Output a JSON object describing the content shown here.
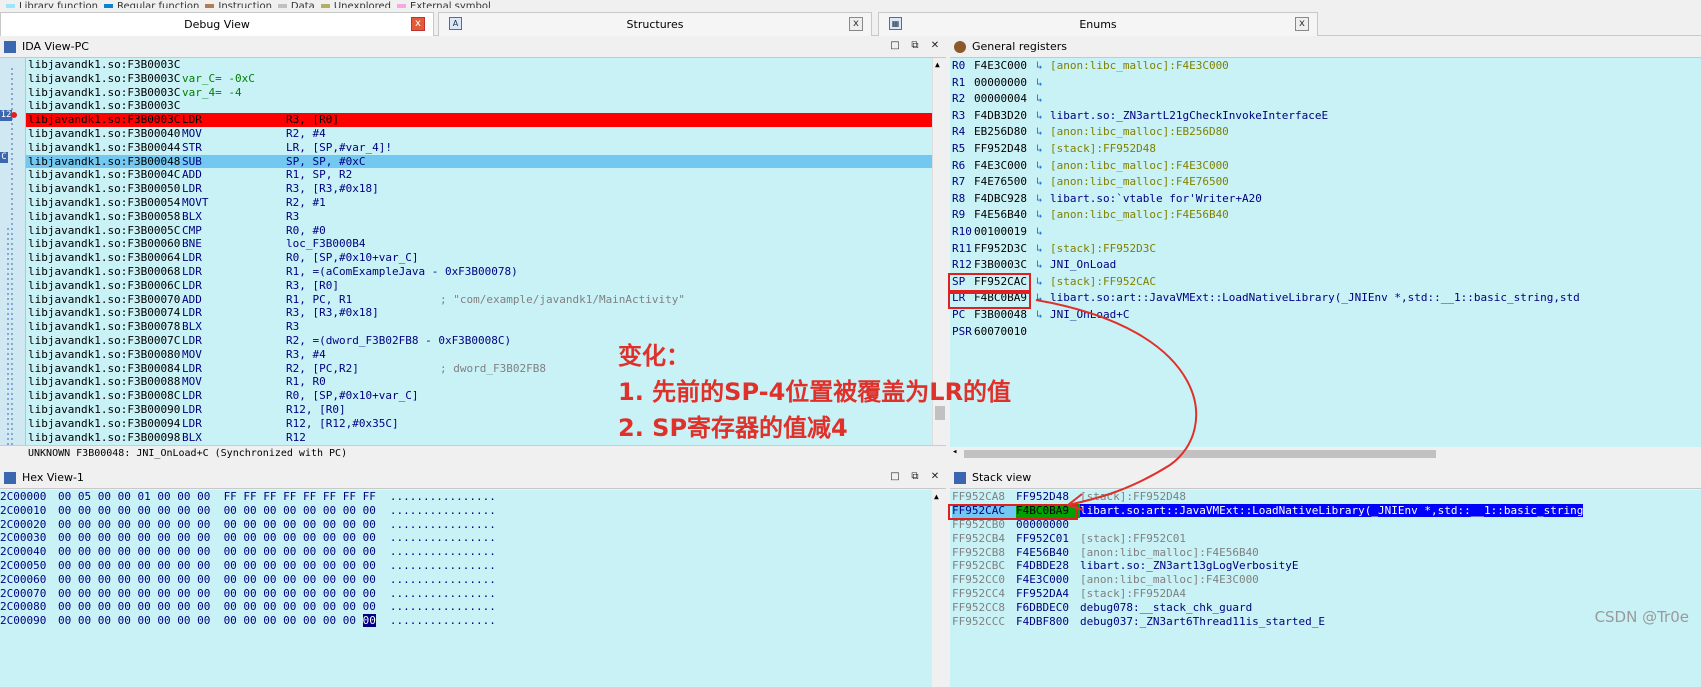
{
  "legend": [
    {
      "label": "Library function",
      "color": "#9be6ff"
    },
    {
      "label": "Regular function",
      "color": "#0a84d0"
    },
    {
      "label": "Instruction",
      "color": "#b47c52"
    },
    {
      "label": "Data",
      "color": "#c0c0c0"
    },
    {
      "label": "Unexplored",
      "color": "#b0b060"
    },
    {
      "label": "External symbol",
      "color": "#f7a6e8"
    }
  ],
  "tabs": [
    {
      "label": "Debug View",
      "close": "x"
    },
    {
      "label": "Structures",
      "close": "x"
    },
    {
      "label": "Enums",
      "close": "x"
    }
  ],
  "ida": {
    "title": "IDA View-PC",
    "gutter_marks": [
      "12",
      "C"
    ],
    "lines": [
      {
        "addr": "libjavandk1.so:F3B0003C",
        "mn": "",
        "ops": "",
        "cm": "",
        "var": "",
        "style": ""
      },
      {
        "addr": "libjavandk1.so:F3B0003C",
        "mn": "",
        "ops": "",
        "cm": "",
        "var": "var_C= -0xC",
        "style": ""
      },
      {
        "addr": "libjavandk1.so:F3B0003C",
        "mn": "",
        "ops": "",
        "cm": "",
        "var": "var_4= -4",
        "style": ""
      },
      {
        "addr": "libjavandk1.so:F3B0003C",
        "mn": "",
        "ops": "",
        "cm": "",
        "var": "",
        "style": ""
      },
      {
        "addr": "libjavandk1.so:F3B0003C",
        "mn": "LDR",
        "ops": "R3, [R0]",
        "cm": "",
        "var": "",
        "style": "red"
      },
      {
        "addr": "libjavandk1.so:F3B00040",
        "mn": "MOV",
        "ops": "R2, #4",
        "cm": "",
        "var": "",
        "style": ""
      },
      {
        "addr": "libjavandk1.so:F3B00044",
        "mn": "STR",
        "ops": "LR, [SP,#var_4]!",
        "cm": "",
        "var": "",
        "style": ""
      },
      {
        "addr": "libjavandk1.so:F3B00048",
        "mn": "SUB",
        "ops": "SP, SP, #0xC",
        "cm": "",
        "var": "",
        "style": "blue"
      },
      {
        "addr": "libjavandk1.so:F3B0004C",
        "mn": "ADD",
        "ops": "R1, SP, R2",
        "cm": "",
        "var": "",
        "style": ""
      },
      {
        "addr": "libjavandk1.so:F3B00050",
        "mn": "LDR",
        "ops": "R3, [R3,#0x18]",
        "cm": "",
        "var": "",
        "style": ""
      },
      {
        "addr": "libjavandk1.so:F3B00054",
        "mn": "MOVT",
        "ops": "R2, #1",
        "cm": "",
        "var": "",
        "style": ""
      },
      {
        "addr": "libjavandk1.so:F3B00058",
        "mn": "BLX",
        "ops": "R3",
        "cm": "",
        "var": "",
        "style": ""
      },
      {
        "addr": "libjavandk1.so:F3B0005C",
        "mn": "CMP",
        "ops": "R0, #0",
        "cm": "",
        "var": "",
        "style": ""
      },
      {
        "addr": "libjavandk1.so:F3B00060",
        "mn": "BNE",
        "ops": "loc_F3B000B4",
        "cm": "",
        "var": "",
        "style": ""
      },
      {
        "addr": "libjavandk1.so:F3B00064",
        "mn": "LDR",
        "ops": "R0, [SP,#0x10+var_C]",
        "cm": "",
        "var": "",
        "style": ""
      },
      {
        "addr": "libjavandk1.so:F3B00068",
        "mn": "LDR",
        "ops": "R1, =(aComExampleJava - 0xF3B00078)",
        "cm": "",
        "var": "",
        "style": ""
      },
      {
        "addr": "libjavandk1.so:F3B0006C",
        "mn": "LDR",
        "ops": "R3, [R0]",
        "cm": "",
        "var": "",
        "style": ""
      },
      {
        "addr": "libjavandk1.so:F3B00070",
        "mn": "ADD",
        "ops": "R1, PC, R1",
        "cm": "; \"com/example/javandk1/MainActivity\"",
        "var": "",
        "style": ""
      },
      {
        "addr": "libjavandk1.so:F3B00074",
        "mn": "LDR",
        "ops": "R3, [R3,#0x18]",
        "cm": "",
        "var": "",
        "style": ""
      },
      {
        "addr": "libjavandk1.so:F3B00078",
        "mn": "BLX",
        "ops": "R3",
        "cm": "",
        "var": "",
        "style": ""
      },
      {
        "addr": "libjavandk1.so:F3B0007C",
        "mn": "LDR",
        "ops": "R2, =(dword_F3B02FB8 - 0xF3B0008C)",
        "cm": "",
        "var": "",
        "style": ""
      },
      {
        "addr": "libjavandk1.so:F3B00080",
        "mn": "MOV",
        "ops": "R3, #4",
        "cm": "",
        "var": "",
        "style": ""
      },
      {
        "addr": "libjavandk1.so:F3B00084",
        "mn": "LDR",
        "ops": "R2, [PC,R2]",
        "cm": "; dword_F3B02FB8",
        "var": "",
        "style": ""
      },
      {
        "addr": "libjavandk1.so:F3B00088",
        "mn": "MOV",
        "ops": "R1, R0",
        "cm": "",
        "var": "",
        "style": ""
      },
      {
        "addr": "libjavandk1.so:F3B0008C",
        "mn": "LDR",
        "ops": "R0, [SP,#0x10+var_C]",
        "cm": "",
        "var": "",
        "style": ""
      },
      {
        "addr": "libjavandk1.so:F3B00090",
        "mn": "LDR",
        "ops": "R12, [R0]",
        "cm": "",
        "var": "",
        "style": ""
      },
      {
        "addr": "libjavandk1.so:F3B00094",
        "mn": "LDR",
        "ops": "R12, [R12,#0x35C]",
        "cm": "",
        "var": "",
        "style": ""
      },
      {
        "addr": "libjavandk1.so:F3B00098",
        "mn": "BLX",
        "ops": "R12",
        "cm": "",
        "var": "",
        "style": ""
      }
    ],
    "status": "UNKNOWN F3B00048: JNI_OnLoad+C (Synchronized with PC)"
  },
  "registers": {
    "title": "General registers",
    "rows": [
      {
        "name": "R0",
        "value": "F4E3C000",
        "desc": "[anon:libc_malloc]:F4E3C000",
        "code": false
      },
      {
        "name": "R1",
        "value": "00000000",
        "desc": "",
        "code": false
      },
      {
        "name": "R2",
        "value": "00000004",
        "desc": "",
        "code": false
      },
      {
        "name": "R3",
        "value": "F4DB3D20",
        "desc": "libart.so:_ZN3artL21gCheckInvokeInterfaceE",
        "code": true
      },
      {
        "name": "R4",
        "value": "EB256D80",
        "desc": "[anon:libc_malloc]:EB256D80",
        "code": false
      },
      {
        "name": "R5",
        "value": "FF952D48",
        "desc": "[stack]:FF952D48",
        "code": false
      },
      {
        "name": "R6",
        "value": "F4E3C000",
        "desc": "[anon:libc_malloc]:F4E3C000",
        "code": false
      },
      {
        "name": "R7",
        "value": "F4E76500",
        "desc": "[anon:libc_malloc]:F4E76500",
        "code": false
      },
      {
        "name": "R8",
        "value": "F4DBC928",
        "desc": "libart.so:`vtable for'Writer+A20",
        "code": true
      },
      {
        "name": "R9",
        "value": "F4E56B40",
        "desc": "[anon:libc_malloc]:F4E56B40",
        "code": false
      },
      {
        "name": "R10",
        "value": "00100019",
        "desc": "",
        "code": false
      },
      {
        "name": "R11",
        "value": "FF952D3C",
        "desc": "[stack]:FF952D3C",
        "code": false
      },
      {
        "name": "R12",
        "value": "F3B0003C",
        "desc": "JNI_OnLoad",
        "code": true
      },
      {
        "name": "SP",
        "value": "FF952CAC",
        "desc": "[stack]:FF952CAC",
        "code": false
      },
      {
        "name": "LR",
        "value": "F4BC0BA9",
        "desc": "libart.so:art::JavaVMExt::LoadNativeLibrary(_JNIEnv *,std::__1::basic_string,std",
        "code": true
      },
      {
        "name": "PC",
        "value": "F3B00048",
        "desc": "JNI_OnLoad+C",
        "code": true
      },
      {
        "name": "PSR",
        "value": "60070010",
        "desc": "",
        "code": false
      }
    ]
  },
  "hex": {
    "title": "Hex View-1",
    "rows": [
      {
        "addr": "2C00000",
        "bytes": "00 05 00 00 01 00 00 00  FF FF FF FF FF FF FF FF",
        "ascii": "................"
      },
      {
        "addr": "2C00010",
        "bytes": "00 00 00 00 00 00 00 00  00 00 00 00 00 00 00 00",
        "ascii": "................"
      },
      {
        "addr": "2C00020",
        "bytes": "00 00 00 00 00 00 00 00  00 00 00 00 00 00 00 00",
        "ascii": "................"
      },
      {
        "addr": "2C00030",
        "bytes": "00 00 00 00 00 00 00 00  00 00 00 00 00 00 00 00",
        "ascii": "................"
      },
      {
        "addr": "2C00040",
        "bytes": "00 00 00 00 00 00 00 00  00 00 00 00 00 00 00 00",
        "ascii": "................"
      },
      {
        "addr": "2C00050",
        "bytes": "00 00 00 00 00 00 00 00  00 00 00 00 00 00 00 00",
        "ascii": "................"
      },
      {
        "addr": "2C00060",
        "bytes": "00 00 00 00 00 00 00 00  00 00 00 00 00 00 00 00",
        "ascii": "................"
      },
      {
        "addr": "2C00070",
        "bytes": "00 00 00 00 00 00 00 00  00 00 00 00 00 00 00 00",
        "ascii": "................"
      },
      {
        "addr": "2C00080",
        "bytes": "00 00 00 00 00 00 00 00  00 00 00 00 00 00 00 00",
        "ascii": "................"
      },
      {
        "addr": "2C00090",
        "bytes": "00 00 00 00 00 00 00 00  00 00 00 00 00 00 00 ",
        "sel": "00",
        "ascii": "................"
      }
    ]
  },
  "stack": {
    "title": "Stack view",
    "rows": [
      {
        "addr": "FF952CA8",
        "value": "FF952D48",
        "desc": "[stack]:FF952D48",
        "code": false,
        "hl": false
      },
      {
        "addr": "FF952CAC",
        "value": "F4BC0BA9",
        "desc": "libart.so:art::JavaVMExt::LoadNativeLibrary(_JNIEnv *,std::__1::basic_string",
        "code": true,
        "hl": true
      },
      {
        "addr": "FF952CB0",
        "value": "00000000",
        "desc": "",
        "code": false,
        "hl": false
      },
      {
        "addr": "FF952CB4",
        "value": "FF952C01",
        "desc": "[stack]:FF952C01",
        "code": false,
        "hl": false
      },
      {
        "addr": "FF952CB8",
        "value": "F4E56B40",
        "desc": "[anon:libc_malloc]:F4E56B40",
        "code": false,
        "hl": false
      },
      {
        "addr": "FF952CBC",
        "value": "F4DBDE28",
        "desc": "libart.so:_ZN3art13gLogVerbosityE",
        "code": true,
        "hl": false
      },
      {
        "addr": "FF952CC0",
        "value": "F4E3C000",
        "desc": "[anon:libc_malloc]:F4E3C000",
        "code": false,
        "hl": false
      },
      {
        "addr": "FF952CC4",
        "value": "FF952DA4",
        "desc": "[stack]:FF952DA4",
        "code": false,
        "hl": false
      },
      {
        "addr": "FF952CC8",
        "value": "F6DBDEC0",
        "desc": "debug078:__stack_chk_guard",
        "code": true,
        "hl": false
      },
      {
        "addr": "FF952CCC",
        "value": "F4DBF800",
        "desc": "debug037:_ZN3art6Thread11is_started_E",
        "code": true,
        "hl": false
      }
    ]
  },
  "annotation": {
    "title": "变化：",
    "line1": "1. 先前的SP-4位置被覆盖为LR的值",
    "line2": "2. SP寄存器的值减4"
  },
  "watermark": "CSDN @Tr0e",
  "colors": {
    "accent_red": "#e0302a",
    "highlight_red": "#ff0000",
    "highlight_blue": "#72c8f1",
    "view_bg": "#c9f2f7"
  }
}
